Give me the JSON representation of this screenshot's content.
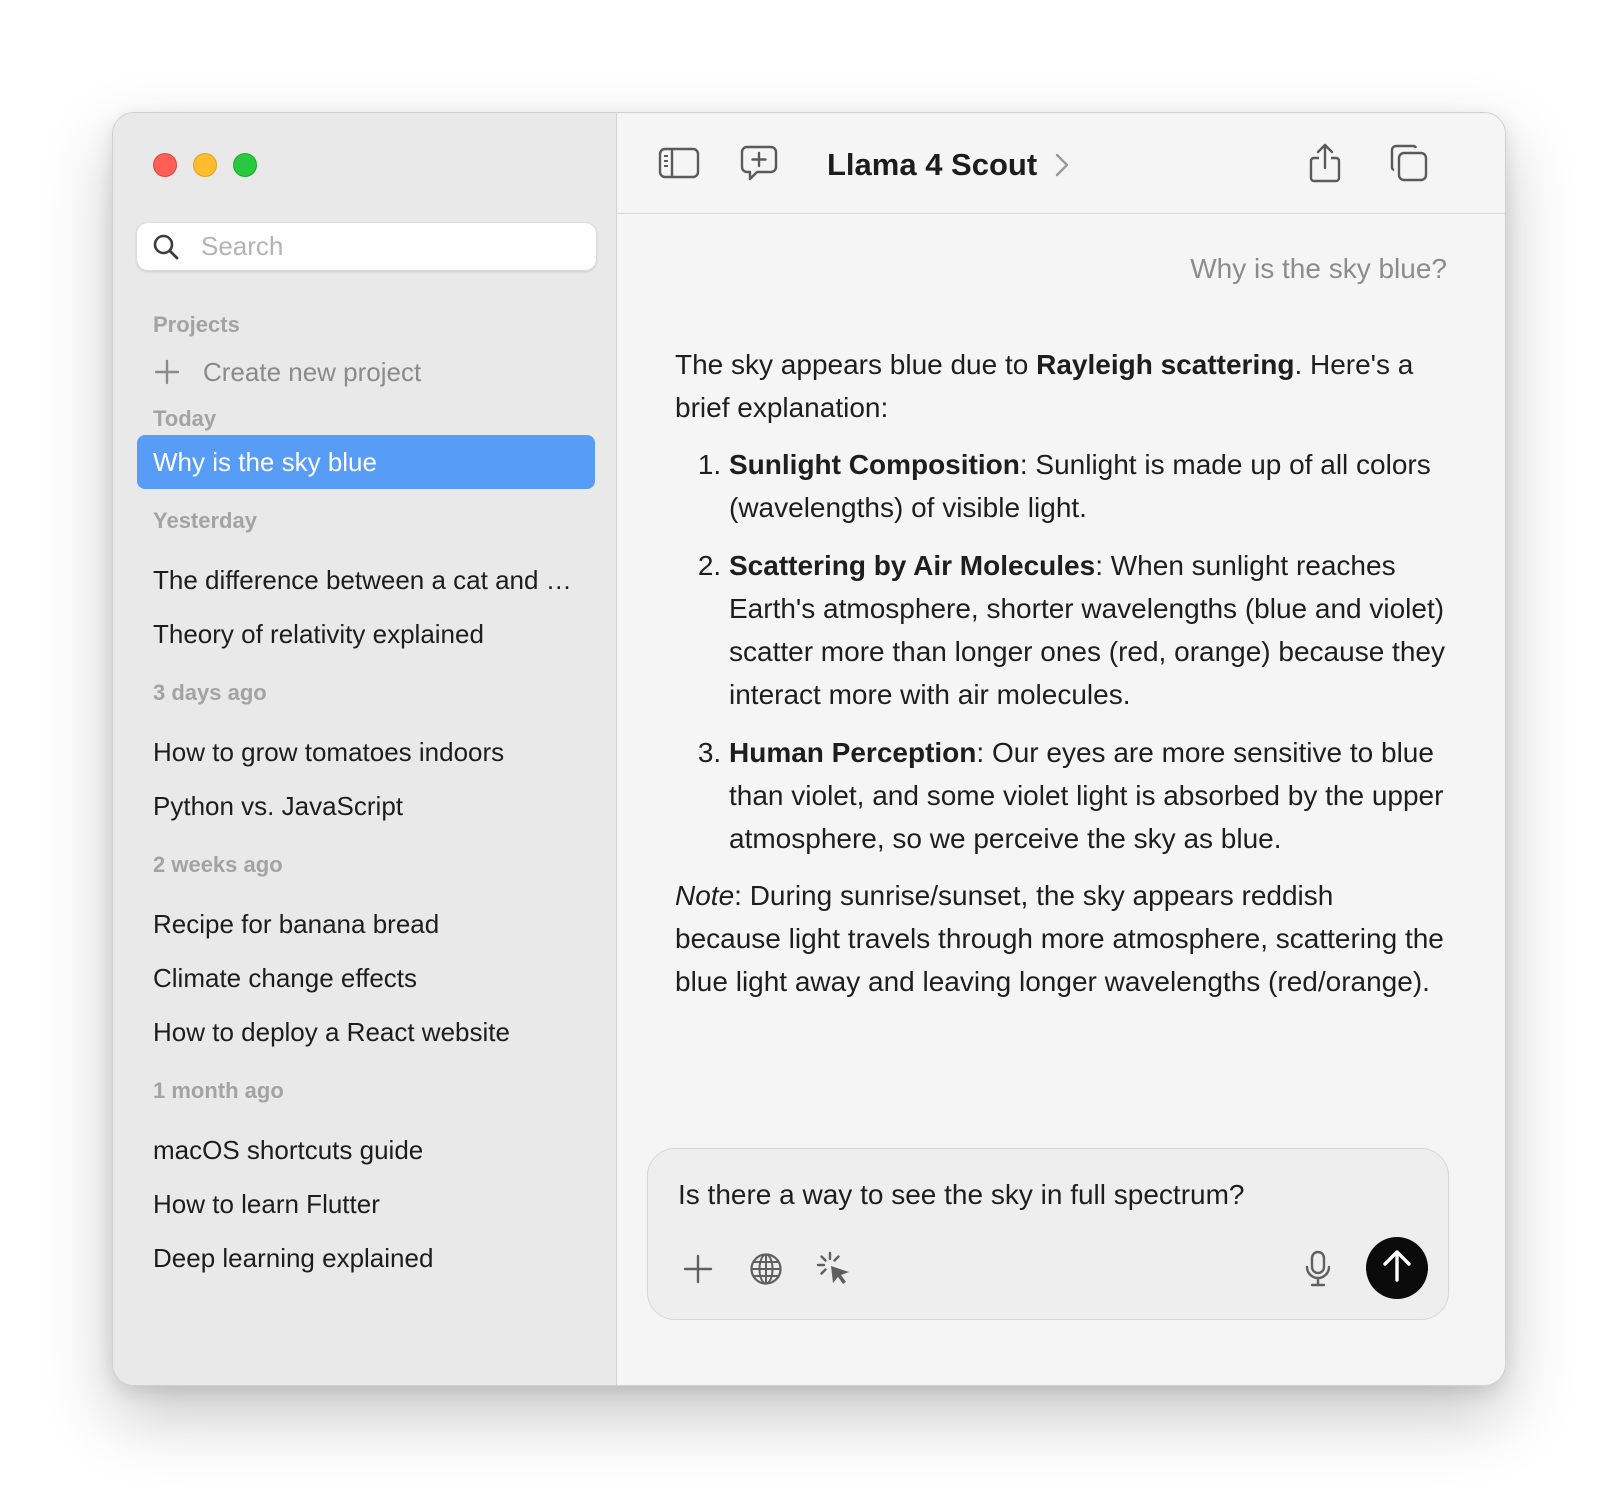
{
  "sidebar": {
    "search_placeholder": "Search",
    "projects_label": "Projects",
    "create_project_label": "Create new project",
    "groups": [
      {
        "label": "Today",
        "items": [
          "Why is the sky blue"
        ]
      },
      {
        "label": "Yesterday",
        "items": [
          "The difference between a cat and a dog",
          "Theory of relativity explained"
        ]
      },
      {
        "label": "3 days ago",
        "items": [
          "How to grow tomatoes indoors",
          "Python vs. JavaScript"
        ]
      },
      {
        "label": "2 weeks ago",
        "items": [
          "Recipe for banana bread",
          "Climate change effects",
          "How to deploy a React website"
        ]
      },
      {
        "label": "1 month ago",
        "items": [
          "macOS shortcuts guide",
          "How to learn Flutter",
          "Deep learning explained"
        ]
      }
    ],
    "active_item": "Why is the sky blue"
  },
  "toolbar": {
    "model_name": "Llama 4 Scout"
  },
  "chat": {
    "user_message": "Why is the sky blue?",
    "answer": {
      "intro_pre": "The sky appears blue due to ",
      "intro_bold": "Rayleigh scattering",
      "intro_post": ". Here's a brief explanation:",
      "points": [
        {
          "title": "Sunlight Composition",
          "text": ": Sunlight is made up of all colors (wavelengths) of visible light."
        },
        {
          "title": "Scattering by Air Molecules",
          "text": ": When sunlight reaches Earth's atmosphere, shorter wavelengths (blue and violet) scatter more than longer ones (red, orange) because they interact more with air molecules."
        },
        {
          "title": "Human Perception",
          "text": ": Our eyes are more sensitive to blue than violet, and some violet light is absorbed by the upper atmosphere, so we perceive the sky as blue."
        }
      ],
      "note_label": "Note",
      "note_text": ": During sunrise/sunset, the sky appears reddish because light travels through more atmosphere, scattering the blue light away and leaving longer wavelengths (red/orange)."
    }
  },
  "composer": {
    "input_value": "Is there a way to see the sky in full spectrum?"
  },
  "colors": {
    "accent": "#579cf7",
    "send_button": "#0b0b0b"
  },
  "icons": [
    "search-icon",
    "plus-icon",
    "sidebar-toggle-icon",
    "new-chat-icon",
    "chevron-right-icon",
    "share-icon",
    "copy-icon",
    "globe-icon",
    "sparkle-cursor-icon",
    "microphone-icon",
    "arrow-up-icon"
  ]
}
